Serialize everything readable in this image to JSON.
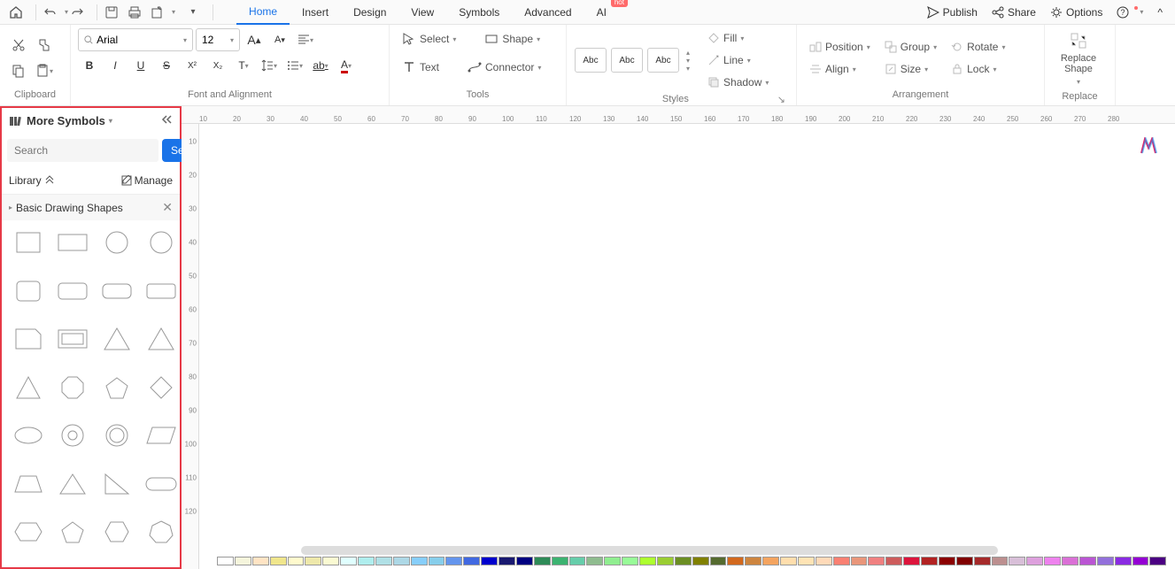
{
  "menu": {
    "items": [
      "Home",
      "Insert",
      "Design",
      "View",
      "Symbols",
      "Advanced",
      "AI"
    ],
    "active_index": 0,
    "ai_badge": "hot"
  },
  "top_right": {
    "publish": "Publish",
    "share": "Share",
    "options": "Options"
  },
  "ribbon": {
    "clipboard": {
      "label": "Clipboard"
    },
    "font": {
      "label": "Font and Alignment",
      "font_name": "Arial",
      "font_size": "12"
    },
    "tools": {
      "label": "Tools",
      "select": "Select",
      "shape": "Shape",
      "text": "Text",
      "connector": "Connector"
    },
    "styles": {
      "label": "Styles",
      "abc": "Abc",
      "fill": "Fill",
      "line": "Line",
      "shadow": "Shadow"
    },
    "arrangement": {
      "label": "Arrangement",
      "position": "Position",
      "align": "Align",
      "group": "Group",
      "size": "Size",
      "rotate": "Rotate",
      "lock": "Lock"
    },
    "replace": {
      "label": "Replace",
      "replace_shape": "Replace Shape"
    }
  },
  "symbols_panel": {
    "title": "More Symbols",
    "search_placeholder": "Search",
    "search_btn": "Search",
    "library": "Library",
    "manage": "Manage",
    "category": "Basic Drawing Shapes"
  },
  "ruler_h": [
    10,
    20,
    30,
    40,
    50,
    60,
    70,
    80,
    90,
    100,
    110,
    120,
    130,
    140,
    150,
    160,
    170,
    180,
    190,
    200,
    210,
    220,
    230,
    240,
    250,
    260,
    270,
    280
  ],
  "ruler_v": [
    10,
    20,
    30,
    40,
    50,
    60,
    70,
    80,
    90,
    100,
    110,
    120
  ],
  "colors": [
    "#ffffff",
    "#f5f5dc",
    "#ffe4c4",
    "#f0e68c",
    "#fffacd",
    "#eee8aa",
    "#fafad2",
    "#e0ffff",
    "#afeeee",
    "#b0e0e6",
    "#add8e6",
    "#87cefa",
    "#87ceeb",
    "#6495ed",
    "#4169e1",
    "#0000cd",
    "#191970",
    "#000080",
    "#2e8b57",
    "#3cb371",
    "#66cdaa",
    "#8fbc8f",
    "#90ee90",
    "#98fb98",
    "#adff2f",
    "#9acd32",
    "#6b8e23",
    "#808000",
    "#556b2f",
    "#d2691e",
    "#cd853f",
    "#f4a460",
    "#ffdead",
    "#ffe4b5",
    "#ffdab9",
    "#fa8072",
    "#e9967a",
    "#f08080",
    "#cd5c5c",
    "#dc143c",
    "#b22222",
    "#8b0000",
    "#800000",
    "#a52a2a",
    "#bc8f8f",
    "#d8bfd8",
    "#dda0dd",
    "#ee82ee",
    "#da70d6",
    "#ba55d3",
    "#9370db",
    "#8a2be2",
    "#9400d3",
    "#4b0082"
  ]
}
